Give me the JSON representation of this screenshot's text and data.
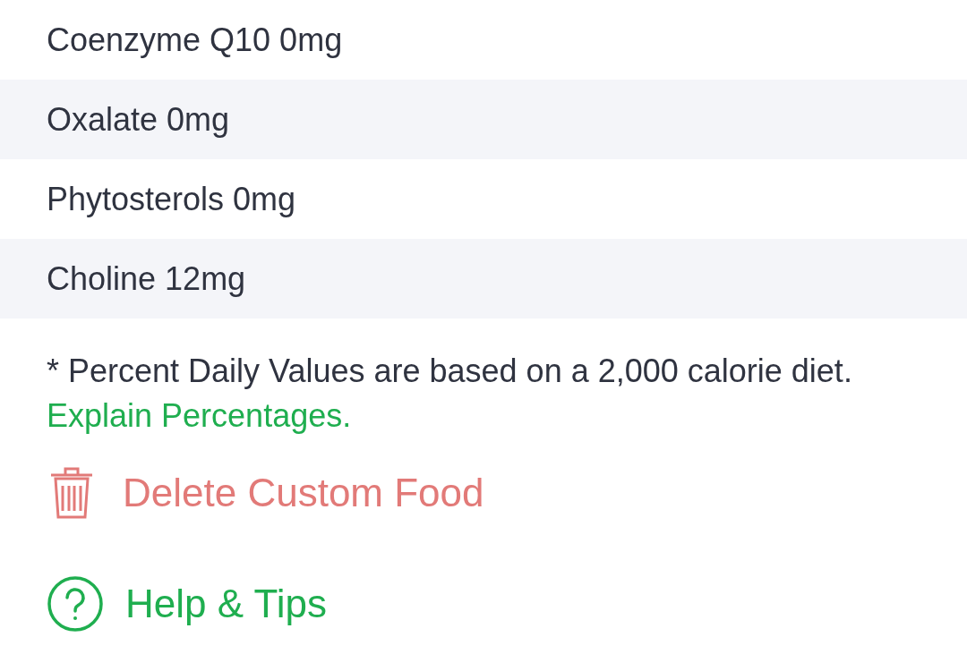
{
  "nutrients": [
    {
      "label": "Coenzyme Q10 0mg"
    },
    {
      "label": "Oxalate 0mg"
    },
    {
      "label": "Phytosterols 0mg"
    },
    {
      "label": "Choline 12mg"
    }
  ],
  "footnote": {
    "text": "* Percent Daily Values are based on a 2,000 calorie diet.",
    "link": "Explain Percentages."
  },
  "actions": [
    {
      "kind": "delete",
      "label": "Delete Custom Food"
    },
    {
      "kind": "help",
      "label": "Help & Tips"
    }
  ]
}
